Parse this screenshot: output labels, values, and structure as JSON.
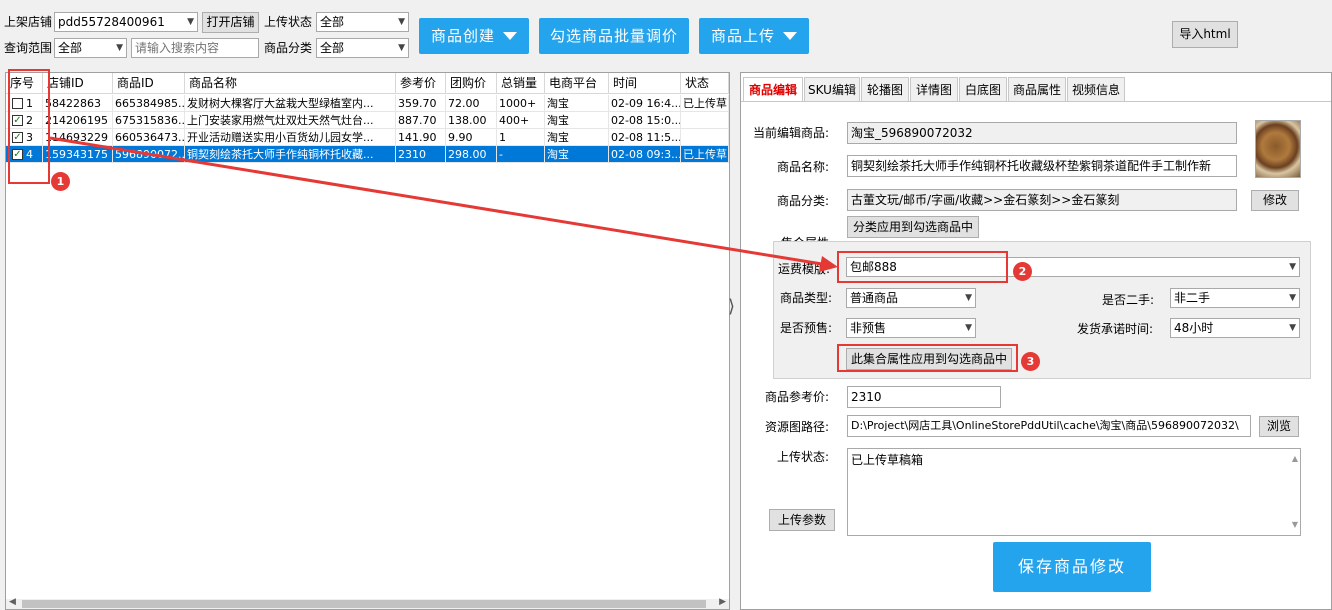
{
  "toolbar": {
    "shop_label": "上架店铺",
    "shop_value": "pdd55728400961",
    "open_shop_button": "打开店铺",
    "upload_status_label": "上传状态",
    "upload_status_value": "全部",
    "query_range_label": "查询范围",
    "query_range_value": "全部",
    "search_placeholder": "请输入搜索内容",
    "category_label": "商品分类",
    "category_value": "全部",
    "create_button": "商品创建",
    "batch_price_button": "勾选商品批量调价",
    "upload_button": "商品上传",
    "import_html_button": "导入html"
  },
  "grid": {
    "columns": [
      "序号",
      "店铺ID",
      "商品ID",
      "商品名称",
      "参考价",
      "团购价",
      "总销量",
      "电商平台",
      "时间",
      "状态"
    ],
    "rows": [
      {
        "checked": false,
        "selected": false,
        "cells": [
          "1",
          "58422863",
          "665384985...",
          "发财树大棵客厅大盆栽大型绿植室内...",
          "359.70",
          "72.00",
          "1000+",
          "淘宝",
          "02-09 16:4...",
          "已上传草"
        ]
      },
      {
        "checked": true,
        "selected": false,
        "cells": [
          "2",
          "214206195",
          "675315836...",
          "上门安装家用燃气灶双灶天然气灶台...",
          "887.70",
          "138.00",
          "400+",
          "淘宝",
          "02-08 15:0...",
          ""
        ]
      },
      {
        "checked": true,
        "selected": false,
        "cells": [
          "3",
          "114693229",
          "660536473...",
          "开业活动赠送实用小百货幼儿园女学...",
          "141.90",
          "9.90",
          "1",
          "淘宝",
          "02-08 11:5...",
          ""
        ]
      },
      {
        "checked": true,
        "selected": true,
        "cells": [
          "4",
          "159343175",
          "596890072...",
          "铜契刻绘茶托大师手作纯铜杯托收藏...",
          "2310",
          "298.00",
          "-",
          "淘宝",
          "02-08 09:3...",
          "已上传草"
        ]
      }
    ]
  },
  "splitter_glyph": "⟩",
  "tabs": [
    "商品编辑",
    "SKU编辑",
    "轮播图",
    "详情图",
    "白底图",
    "商品属性",
    "视频信息"
  ],
  "editor": {
    "current_label": "当前编辑商品:",
    "current_value": "淘宝_596890072032",
    "name_label": "商品名称:",
    "name_value": "铜契刻绘茶托大师手作纯铜杯托收藏级杯垫紫铜茶道配件手工制作新",
    "category_label": "商品分类:",
    "category_value": "古董文玩/邮币/字画/收藏>>金石篆刻>>金石篆刻",
    "modify_button": "修改",
    "apply_category_button": "分类应用到勾选商品中",
    "collection_title": "集合属性",
    "freight_label": "运费模版:",
    "freight_value": "包邮888",
    "goods_type_label": "商品类型:",
    "goods_type_value": "普通商品",
    "second_hand_label": "是否二手:",
    "second_hand_value": "非二手",
    "presale_label": "是否预售:",
    "presale_value": "非预售",
    "ship_time_label": "发货承诺时间:",
    "ship_time_value": "48小时",
    "apply_attr_button": "此集合属性应用到勾选商品中",
    "ref_price_label": "商品参考价:",
    "ref_price_value": "2310",
    "path_label": "资源图路径:",
    "path_value": "D:\\Project\\网店工具\\OnlineStorePddUtil\\cache\\淘宝\\商品\\596890072032\\",
    "browse_button": "浏览",
    "upload_status_label": "上传状态:",
    "upload_status_value": "已上传草稿箱",
    "upload_params_button": "上传参数",
    "save_button": "保存商品修改"
  },
  "annotations": [
    "1",
    "2",
    "3"
  ],
  "colors": {
    "accent_blue": "#25a4ee",
    "selection_blue": "#0078d7",
    "annotation_red": "#e53935",
    "active_tab_red": "#e00000"
  }
}
